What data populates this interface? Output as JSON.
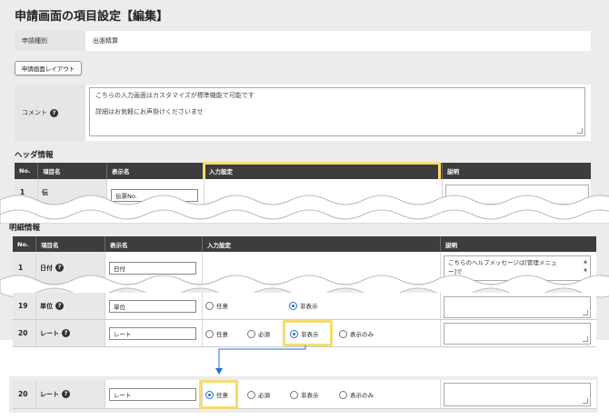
{
  "page_title": "申請画面の項目設定【編集】",
  "form": {
    "type_label": "申請種別",
    "type_value": "出張精算",
    "layout_button": "申請画面レイアウト",
    "comment_label": "コメント",
    "comment_line1": "こちらの入力画面はカスタマイズが標準機能で可能です",
    "comment_line2": "詳細はお気軽にお声掛けくださいませ"
  },
  "header_section": {
    "title": "ヘッダ情報",
    "columns": [
      "No.",
      "項目名",
      "表示名",
      "入力設定",
      "説明"
    ],
    "partial_row": {
      "no": "1",
      "name": "伝",
      "display": "伝票No."
    }
  },
  "detail_section": {
    "title": "明細情報",
    "columns": [
      "No.",
      "項目名",
      "表示名",
      "入力設定",
      "説明"
    ],
    "row1": {
      "no": "1",
      "name": "日付",
      "display": "日付",
      "desc_line1": "こちらのヘルプメッセージは[管理メニュ",
      "desc_line2": "ー]で"
    },
    "row19": {
      "no": "19",
      "name": "単位",
      "display": "単位",
      "opt_optional": "任意",
      "opt_hidden": "非表示"
    },
    "row20": {
      "no": "20",
      "name": "レート",
      "display": "レート",
      "opt_optional": "任意",
      "opt_required": "必須",
      "opt_hidden": "非表示",
      "opt_display_only": "表示のみ",
      "selected": "非表示"
    }
  },
  "after": {
    "row20": {
      "no": "20",
      "name": "レート",
      "display": "レート",
      "opt_optional": "任意",
      "opt_required": "必須",
      "opt_hidden": "非表示",
      "opt_display_only": "表示のみ",
      "selected": "任意"
    }
  },
  "colors": {
    "highlight": "#f7dc6f",
    "arrow": "#2a6fd0",
    "header_bg": "#3d3d3d"
  }
}
